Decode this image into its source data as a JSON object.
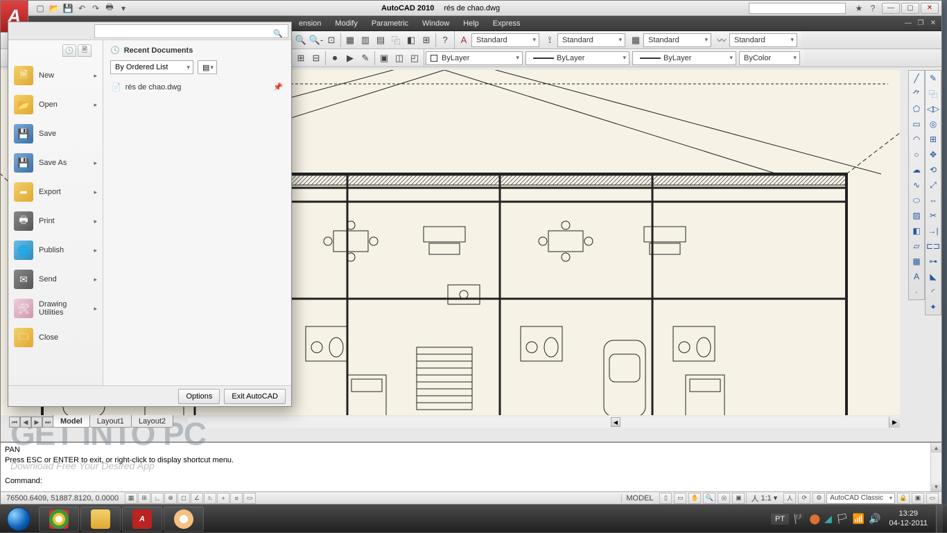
{
  "title": {
    "app": "AutoCAD 2010",
    "doc": "rés de chao.dwg"
  },
  "menubar": [
    "ension",
    "Modify",
    "Parametric",
    "Window",
    "Help",
    "Express"
  ],
  "standards": {
    "std": "Standard"
  },
  "layer_row": {
    "layer": "ByLayer",
    "ltype": "ByLayer",
    "lweight": "ByLayer",
    "plot": "ByColor"
  },
  "appmenu": {
    "items": [
      {
        "label": "New",
        "ic": "folder"
      },
      {
        "label": "Open",
        "ic": "folder"
      },
      {
        "label": "Save",
        "ic": "disk"
      },
      {
        "label": "Save As",
        "ic": "disk"
      },
      {
        "label": "Export",
        "ic": "folder"
      },
      {
        "label": "Print",
        "ic": "print"
      },
      {
        "label": "Publish",
        "ic": "globe"
      },
      {
        "label": "Send",
        "ic": "send"
      },
      {
        "label": "Drawing\nUtilities",
        "ic": "draw"
      },
      {
        "label": "Close",
        "ic": "folder"
      }
    ],
    "recent_head": "Recent Documents",
    "order": "By Ordered List",
    "recent_file": "rés de chao.dwg",
    "options": "Options",
    "exit": "Exit AutoCAD",
    "search_ph": ""
  },
  "tabs": {
    "model": "Model",
    "l1": "Layout1",
    "l2": "Layout2"
  },
  "cmd": {
    "l1": "PAN",
    "l2": "Press ESC or ENTER to exit, or right-click to display shortcut menu.",
    "prompt": "Command:"
  },
  "status": {
    "coords": "76500.6409, 51887.8120, 0.0000",
    "model": "MODEL",
    "scale": "1:1",
    "workspace": "AutoCAD Classic"
  },
  "taskbar": {
    "lang": "PT",
    "time": "13:29",
    "date": "04-12-2011"
  },
  "watermark": {
    "big": "GET INTO PC",
    "sub": "Download Free Your Desired App"
  }
}
